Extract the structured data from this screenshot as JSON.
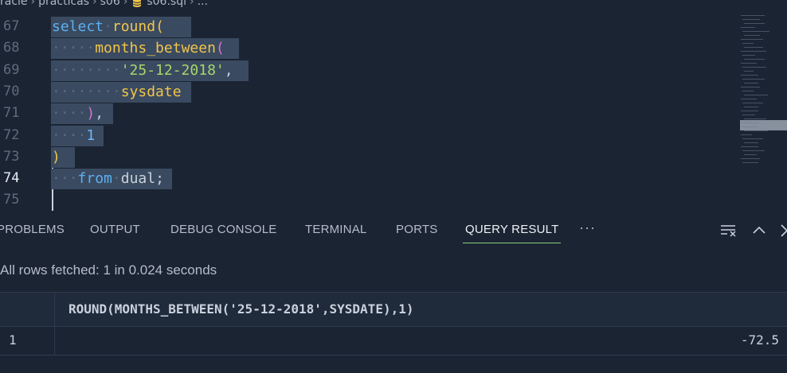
{
  "breadcrumb": {
    "items": [
      "racle",
      "practicas",
      "s06"
    ],
    "file": "s06.sql",
    "ellipsis": "..."
  },
  "editor": {
    "lines": [
      {
        "number": "67",
        "indent": "",
        "tokens": [
          {
            "t": "select",
            "c": "kw"
          },
          {
            "t": " ",
            "c": "ws"
          },
          {
            "t": "round",
            "c": "fn"
          },
          {
            "t": "(",
            "c": "paren-y"
          }
        ]
      },
      {
        "number": "68",
        "indent": "··",
        "tokens": [
          {
            "t": " ",
            "c": "ws"
          },
          {
            "t": "months_between",
            "c": "fn"
          },
          {
            "t": "(",
            "c": "paren-p"
          }
        ]
      },
      {
        "number": "69",
        "indent": "····",
        "tokens": [
          {
            "t": "'25-12-2018'",
            "c": "str"
          },
          {
            "t": ",",
            "c": "plain"
          }
        ]
      },
      {
        "number": "70",
        "indent": "····",
        "tokens": [
          {
            "t": "sysdate",
            "c": "fn"
          }
        ]
      },
      {
        "number": "71",
        "indent": "··",
        "tokens": [
          {
            "t": ")",
            "c": "paren-p"
          },
          {
            "t": ",",
            "c": "plain"
          }
        ]
      },
      {
        "number": "72",
        "indent": "··",
        "tokens": [
          {
            "t": "1",
            "c": "num"
          }
        ]
      },
      {
        "number": "73",
        "indent": "",
        "tokens": [
          {
            "t": ")",
            "c": "paren-y"
          }
        ]
      },
      {
        "number": "74",
        "indent": "·",
        "tokens": [
          {
            "t": " ",
            "c": "ws"
          },
          {
            "t": "from",
            "c": "kw"
          },
          {
            "t": " ",
            "c": "ws"
          },
          {
            "t": "dual;",
            "c": "plain"
          }
        ]
      },
      {
        "number": "75",
        "indent": "",
        "tokens": []
      }
    ],
    "active_line": "74"
  },
  "panel": {
    "tabs": [
      "PROBLEMS",
      "OUTPUT",
      "DEBUG CONSOLE",
      "TERMINAL",
      "PORTS",
      "QUERY RESULT"
    ],
    "active_tab": "QUERY RESULT",
    "more": "···"
  },
  "status": {
    "text": "All rows fetched: 1 in 0.024 seconds"
  },
  "results": {
    "columns": [
      "ROUND(MONTHS_BETWEEN('25-12-2018',SYSDATE),1)"
    ],
    "rows": [
      {
        "row_number": "1",
        "values": [
          "-72.5"
        ]
      }
    ]
  },
  "colors": {
    "accent_underline": "#8ad17a",
    "background": "#1b2433",
    "selection": "#3a4a60"
  }
}
